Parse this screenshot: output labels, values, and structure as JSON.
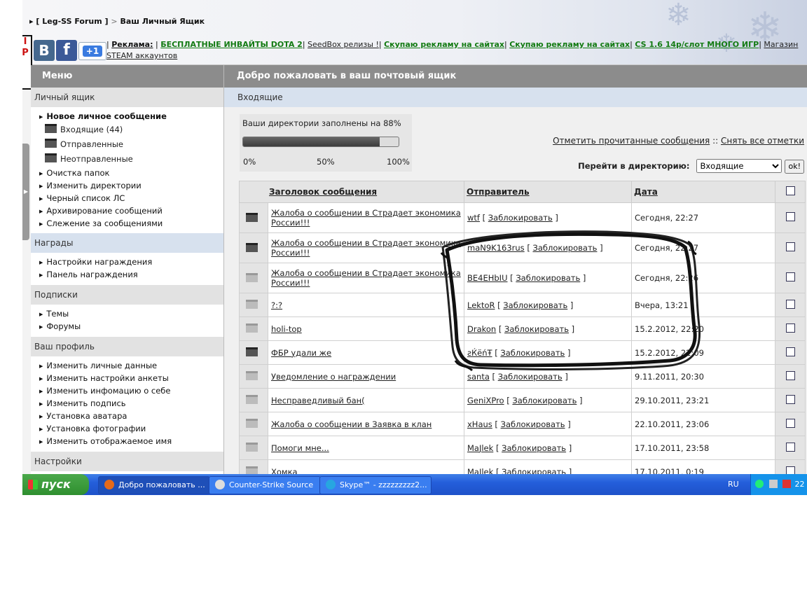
{
  "header": {
    "breadcrumb": {
      "site": "[ Leg-SS Forum ]",
      "separator": ">",
      "page": "Ваш Личный Ящик"
    },
    "left_badge": "I\nP",
    "social": {
      "vk": "В",
      "fb": "f",
      "gplus": "+1"
    },
    "ads": {
      "label": "Реклама:",
      "items": [
        "БЕСПЛАТНЫЕ ИНВАЙТЫ DOTA 2",
        "SeedBox релизы !",
        "Скупаю рекламу на сайтах",
        "Скупаю рекламу на сайтах",
        "CS 1.6 14р/слот МНОГО ИГР",
        "Магазин STEAM аккаунтов"
      ]
    }
  },
  "sidebar": {
    "title": "Меню",
    "sections": [
      {
        "title": "Личный ящик",
        "items": [
          "Новое личное сообщение"
        ],
        "folders": [
          "Входящие (44)",
          "Отправленные",
          "Неотправленные"
        ],
        "more": [
          "Очистка папок",
          "Изменить директории",
          "Черный список ЛС",
          "Архивирование сообщений",
          "Слежение за сообщениями"
        ]
      },
      {
        "title": "Награды",
        "items": [
          "Настройки награждения",
          "Панель награждения"
        ]
      },
      {
        "title": "Подписки",
        "items": [
          "Темы",
          "Форумы"
        ]
      },
      {
        "title": "Ваш профиль",
        "items": [
          "Изменить личные данные",
          "Изменить настройки анкеты",
          "Изменить инфомацию о себе",
          "Изменить подпись",
          "Установка аватара",
          "Установка фотографии",
          "Изменить отображаемое имя"
        ]
      },
      {
        "title": "Настройки",
        "items": []
      }
    ]
  },
  "main": {
    "title": "Добро пожаловать в ваш почтовый ящик",
    "folder": "Входящие",
    "quota": {
      "text": "Ваши директории заполнены на 88%",
      "percent": 88,
      "scale": [
        "0%",
        "50%",
        "100%"
      ]
    },
    "mark_read": "Отметить прочитанные сообщения",
    "link_sep": "::",
    "uncheck_all": "Снять все отметки",
    "goto_label": "Перейти в директорию:",
    "goto_selected": "Входящие",
    "goto_ok": "ok!",
    "columns": {
      "subject": "Заголовок сообщения",
      "sender": "Отправитель",
      "date": "Дата"
    },
    "block_label": "Заблокировать"
  },
  "messages": [
    {
      "subject": "Жалоба о сообщении в Страдает экономика России!!!",
      "sender": "wtf",
      "date": "Сегодня, 22:27",
      "read": false
    },
    {
      "subject": "Жалоба о сообщении в Страдает экономика России!!!",
      "sender": "maN9K163rus",
      "date": "Сегодня, 22:27",
      "read": false
    },
    {
      "subject": "Жалоба о сообщении в Страдает экономика России!!!",
      "sender": "BE4EHbIU",
      "date": "Сегодня, 22:26",
      "read": true
    },
    {
      "subject": "?:?",
      "sender": "LektoR",
      "date": "Вчера, 13:21",
      "read": true
    },
    {
      "subject": "holi-top",
      "sender": "Drakon",
      "date": "15.2.2012, 22:20",
      "read": true
    },
    {
      "subject": "ФБР удали же",
      "sender": "ƨЌёńŦ",
      "date": "15.2.2012, 22:09",
      "read": false
    },
    {
      "subject": "Уведомление о награждении",
      "sender": "santa",
      "date": "9.11.2011, 20:30",
      "read": true
    },
    {
      "subject": "Несправедливый бан(",
      "sender": "GeniXPro",
      "date": "29.10.2011, 23:21",
      "read": true
    },
    {
      "subject": "Жалоба о сообщении в Заявка в клан",
      "sender": "xHaus",
      "date": "22.10.2011, 23:06",
      "read": true
    },
    {
      "subject": "Помоги мне...",
      "sender": "MaJlek",
      "date": "17.10.2011, 23:58",
      "read": true
    },
    {
      "subject": "Хомка",
      "sender": "MaJlek",
      "date": "17.10.2011, 0:19",
      "read": true
    }
  ],
  "taskbar": {
    "start": "пуск",
    "tasks": [
      "Добро пожаловать ...",
      "Counter-Strike Source",
      "Skype™ - zzzzzzzzz2..."
    ],
    "lang": "RU",
    "clock": "22"
  },
  "colors": {
    "read_icon": "#bcbcbc",
    "unread_icon": "#444444",
    "ad_green": "#117a11",
    "header_gray": "#8c8c8c"
  }
}
